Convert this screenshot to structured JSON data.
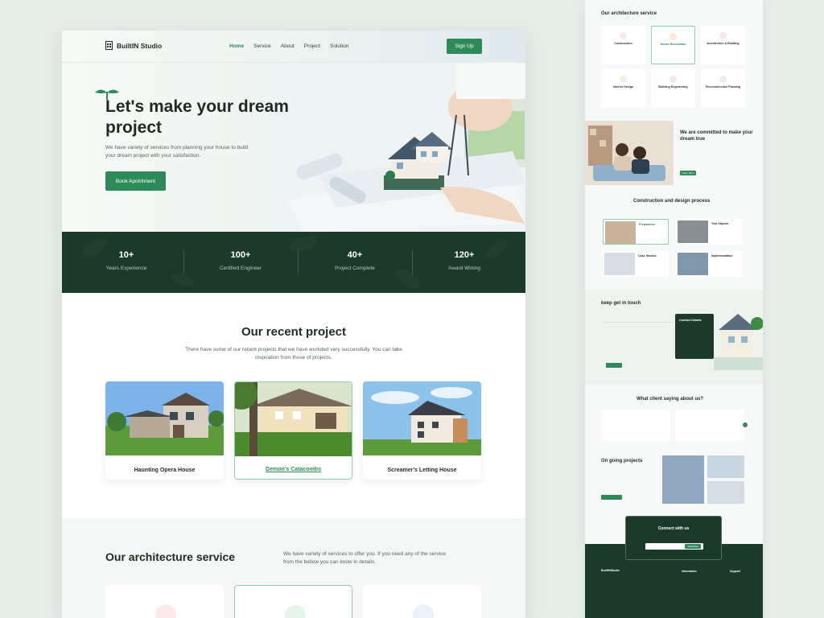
{
  "nav": {
    "brand": "BuiltIN Studio",
    "links": [
      "Home",
      "Service",
      "About",
      "Project",
      "Solution"
    ],
    "active": "Home",
    "signup": "Sign Up"
  },
  "hero": {
    "title": "Let's make your dream project",
    "subtitle": "We have variety of services from planning your house to build your dream project with your satisfaction.",
    "button": "Book Apointment"
  },
  "stats": [
    {
      "value": "10+",
      "label": "Years Experience"
    },
    {
      "value": "100+",
      "label": "Certified Engineer"
    },
    {
      "value": "40+",
      "label": "Project Complete"
    },
    {
      "value": "120+",
      "label": "Award Wining"
    }
  ],
  "recent": {
    "title": "Our recent project",
    "subtitle": "There have some of our recent projects that we have workded very successfully. You can take inspiration from those of projects.",
    "projects": [
      "Haunting Opera House",
      "Demon's Catacombs",
      "Screamer's Letting House"
    ]
  },
  "service": {
    "title": "Our architecture service",
    "subtitle": "We have variety of services to offer you. If you need any of the service from the bellow you can know in details."
  },
  "preview": {
    "service_title": "Our architecture service",
    "services": [
      "Construction",
      "House Renovation",
      "Architecture & Building",
      "Interior Design",
      "Building Engineering",
      "Preconstruction Planning"
    ],
    "committed_title": "We are committed to make your dream true",
    "learn_more": "Learn More",
    "process_title": "Construction and design process",
    "process": [
      "Preparation",
      "Test Objects",
      "Case Studies",
      "Implementation"
    ],
    "touch_title": "keep get in touch",
    "contact_title": "Contact Details",
    "testimonial_title": "What client saying about us?",
    "ongoing_title": "On going projects",
    "connect_title": "Connect with us",
    "subscribe": "Subscribe",
    "footer_brand": "BuiltINStudio",
    "footer_cols": [
      "Information",
      "Support"
    ]
  },
  "colors": {
    "accent": "#2f8a5a",
    "dark": "#1c3a2a",
    "background": "#e6ece8"
  }
}
